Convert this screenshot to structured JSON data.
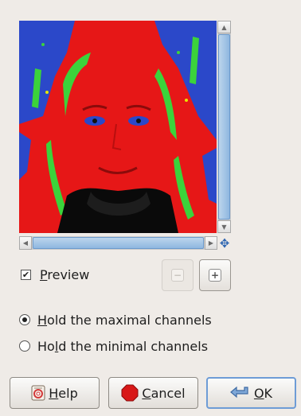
{
  "preview": {
    "checkbox_label": "Preview",
    "checkbox_mnemonic": "P",
    "checkbox_rest": "review",
    "checked": true
  },
  "zoom": {
    "zoom_out_icon": "zoom-out-icon",
    "zoom_in_icon": "zoom-in-icon",
    "zoom_out_enabled": false
  },
  "options": {
    "items": [
      {
        "label": "Hold the maximal channels",
        "mnemonic": "H",
        "rest": "old the maximal channels",
        "selected": true
      },
      {
        "label": "Hold the minimal channels",
        "pre": "Ho",
        "mnemonic": "l",
        "rest": "d the minimal channels",
        "selected": false
      }
    ]
  },
  "buttons": {
    "help": {
      "label": "Help",
      "mnemonic": "H",
      "rest": "elp",
      "icon": "help-icon"
    },
    "cancel": {
      "label": "Cancel",
      "mnemonic": "C",
      "rest": "ancel",
      "icon": "cancel-icon"
    },
    "ok": {
      "label": "OK",
      "mnemonic": "O",
      "rest": "K",
      "icon": "ok-icon"
    }
  },
  "colors": {
    "background": "#efebe7",
    "preview_red": "#e61717",
    "preview_blue": "#2b48c9",
    "preview_green": "#3bd33b",
    "scroll_thumb": "#8fb7e0"
  }
}
